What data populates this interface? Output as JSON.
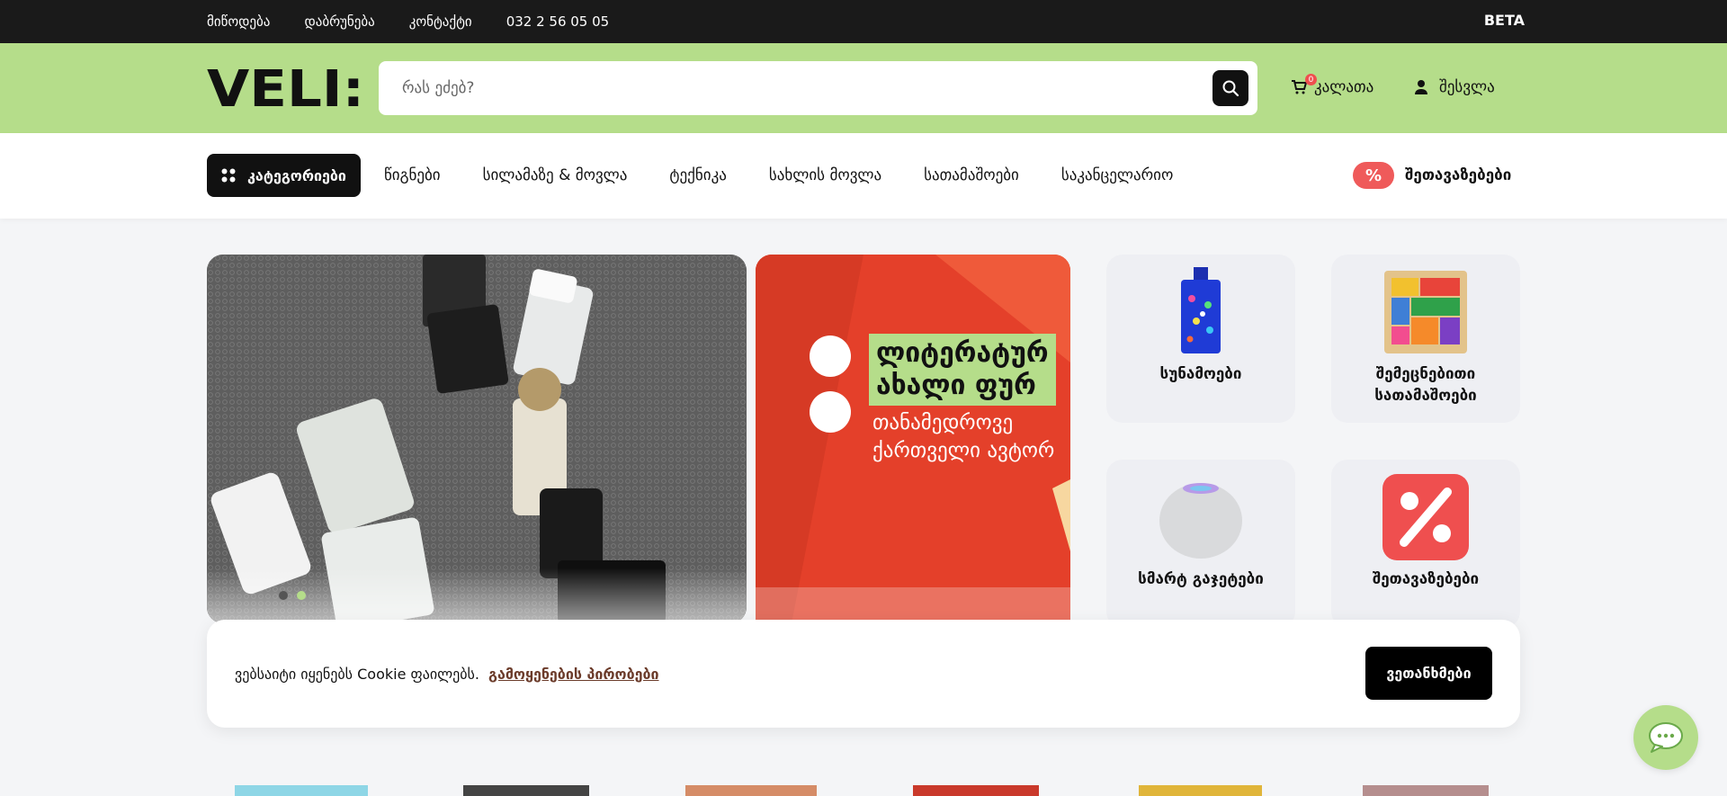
{
  "topbar": {
    "links": [
      "მიწოდება",
      "დაბრუნება",
      "კონტაქტი",
      "032 2 56 05 05"
    ],
    "beta": "BETA"
  },
  "header": {
    "logo": "VELI:",
    "search_placeholder": "რას ეძებ?",
    "cart_label": "კალათა",
    "cart_count": "0",
    "login_label": "შესვლა"
  },
  "nav": {
    "categories_label": "კატეგორიები",
    "items": [
      "წიგნები",
      "სილამაზე & მოვლა",
      "ტექნიკა",
      "სახლის მოვლა",
      "სათამაშოები",
      "საკანცელარიო"
    ],
    "deals_badge": "%",
    "deals_label": "შეთავაზებები"
  },
  "banner2": {
    "line1": "ლიტერატურ",
    "line2": "ახალი ფურ",
    "line3": "თანამედროვე",
    "line4": "ქართველი ავტორ"
  },
  "categories": [
    {
      "label": "სუნამოები",
      "icon": "perfume-bottle-icon"
    },
    {
      "label": "შემეცნებითი სათამაშოები",
      "icon": "puzzle-icon"
    },
    {
      "label": "სმარტ გაჯეტები",
      "icon": "smart-speaker-icon"
    },
    {
      "label": "შეთავაზებები",
      "icon": "percent-icon"
    }
  ],
  "cookie": {
    "text": "ვებსაიტი იყენებს Cookie ფაილებს.",
    "link": "გამოყენების პირობები",
    "accept": "ვეთანხმები"
  },
  "colors": {
    "brand_green": "#b5dd8a",
    "dark": "#1a1a1a",
    "deal_red": "#ef5a5a"
  }
}
